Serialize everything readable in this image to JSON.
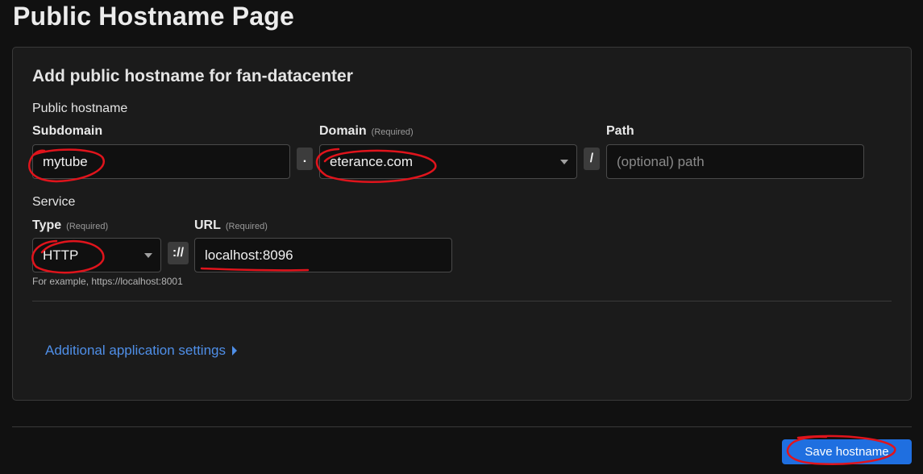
{
  "page": {
    "title": "Public Hostname Page"
  },
  "card": {
    "title": "Add public hostname for fan-datacenter",
    "public_hostname_label": "Public hostname",
    "subdomain": {
      "label": "Subdomain",
      "value": "mytube"
    },
    "dot_separator": ".",
    "domain": {
      "label": "Domain",
      "required": "(Required)",
      "value": "eterance.com"
    },
    "slash_separator": "/",
    "path": {
      "label": "Path",
      "placeholder": "(optional) path"
    },
    "service_label": "Service",
    "type": {
      "label": "Type",
      "required": "(Required)",
      "value": "HTTP"
    },
    "scheme_separator": "://",
    "url": {
      "label": "URL",
      "required": "(Required)",
      "value": "localhost:8096"
    },
    "hint": "For example, https://localhost:8001",
    "additional_settings": "Additional application settings"
  },
  "footer": {
    "save_label": "Save hostname"
  },
  "colors": {
    "annotation": "#e0141c",
    "accent": "#1f6fe0",
    "link": "#4f8fe8"
  },
  "icons": [
    "chevron-down-icon",
    "caret-right-icon"
  ]
}
